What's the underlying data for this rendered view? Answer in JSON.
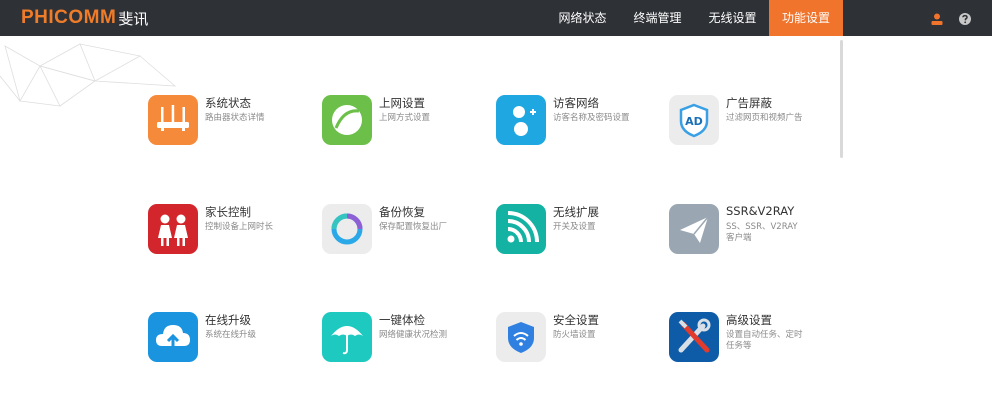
{
  "header": {
    "logo_en": "PHICOMM",
    "logo_cn": "斐讯",
    "nav": [
      {
        "label": "网络状态"
      },
      {
        "label": "终端管理"
      },
      {
        "label": "无线设置"
      },
      {
        "label": "功能设置"
      }
    ],
    "active_nav": "功能设置",
    "icons": [
      "user-icon",
      "help-icon"
    ]
  },
  "colors": {
    "topbar": "#2e3136",
    "accent": "#f0742b"
  },
  "features": [
    {
      "title": "系统状态",
      "desc": "路由器状态详情",
      "icon": "router-icon",
      "color": "#f58a3a"
    },
    {
      "title": "上网设置",
      "desc": "上网方式设置",
      "icon": "globe-icon",
      "color": "#6cc04a"
    },
    {
      "title": "访客网络",
      "desc": "访客名称及密码设置",
      "icon": "guest-icon",
      "color": "#1ea7e1"
    },
    {
      "title": "广告屏蔽",
      "desc": "过滤网页和视频广告",
      "icon": "ad-block-icon",
      "color": "#ececec"
    },
    {
      "title": "家长控制",
      "desc": "控制设备上网时长",
      "icon": "family-icon",
      "color": "#d2262c"
    },
    {
      "title": "备份恢复",
      "desc": "保存配置恢复出厂",
      "icon": "backup-icon",
      "color": "#ececec"
    },
    {
      "title": "无线扩展",
      "desc": "开关及设置",
      "icon": "wifi-extend-icon",
      "color": "#14b2a3"
    },
    {
      "title": "SSR&V2RAY",
      "desc": "SS、SSR、V2RAY客户端",
      "icon": "paper-plane-icon",
      "color": "#9aa7b2"
    },
    {
      "title": "在线升级",
      "desc": "系统在线升级",
      "icon": "cloud-upload-icon",
      "color": "#1b94e0"
    },
    {
      "title": "一键体检",
      "desc": "网络健康状况检测",
      "icon": "umbrella-icon",
      "color": "#1ec9c0"
    },
    {
      "title": "安全设置",
      "desc": "防火墙设置",
      "icon": "shield-wifi-icon",
      "color": "#ececec"
    },
    {
      "title": "高级设置",
      "desc": "设置自动任务、定时任务等",
      "icon": "tools-icon",
      "color": "#0e5ca8"
    }
  ]
}
